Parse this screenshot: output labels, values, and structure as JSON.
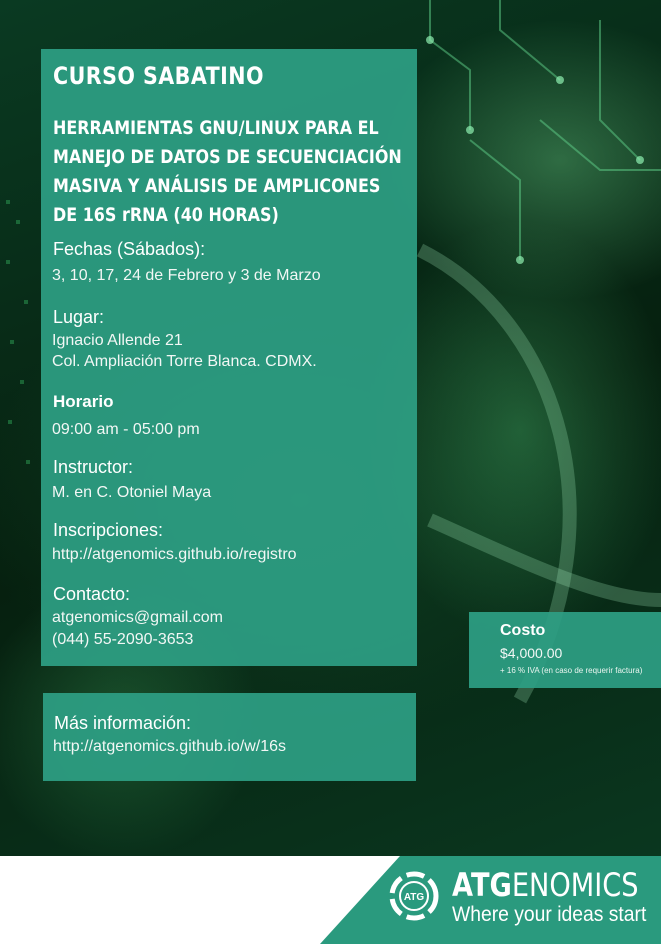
{
  "main": {
    "title": "CURSO SABATINO",
    "subtitle_lines": [
      "HERRAMIENTAS GNU/LINUX PARA EL",
      "MANEJO DE DATOS DE SECUENCIACIÓN",
      "MASIVA Y ANÁLISIS DE AMPLICONES",
      "DE 16S rRNA (40 HORAS)"
    ],
    "fechas_label": "Fechas (Sábados):",
    "fechas_value": "3, 10, 17, 24 de Febrero y 3 de Marzo",
    "lugar_label": "Lugar:",
    "lugar_line1": "Ignacio Allende 21",
    "lugar_line2": "Col. Ampliación Torre Blanca. CDMX.",
    "horario_label": "Horario",
    "horario_value": "09:00 am -  05:00 pm",
    "instructor_label": "Instructor:",
    "instructor_value": "M. en C. Otoniel Maya",
    "inscripciones_label": "Inscripciones:",
    "inscripciones_value": "http://atgenomics.github.io/registro",
    "contacto_label": "Contacto:",
    "contacto_email": "atgenomics@gmail.com",
    "contacto_phone": "(044) 55-2090-3653"
  },
  "cost": {
    "label": "Costo",
    "value": "$4,000.00",
    "note": "+ 16 % IVA (en caso de requerir factura)"
  },
  "info": {
    "label": "Más información:",
    "value": "http://atgenomics.github.io/w/16s"
  },
  "footer": {
    "logo_text": "ATG",
    "brand_bold": "ATG",
    "brand_rest": "ENOMICS",
    "tagline": "Where your ideas start"
  },
  "colors": {
    "panel": "#2ea084",
    "footer_teal": "#2a9a7e",
    "footer_white": "#ffffff"
  }
}
